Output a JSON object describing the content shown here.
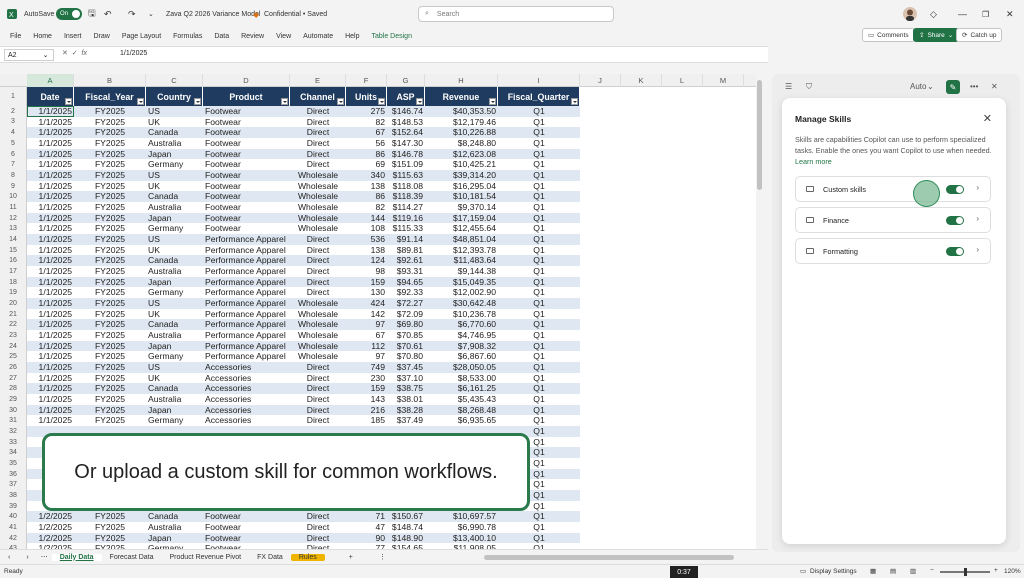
{
  "titlebar": {
    "autosave_label": "AutoSave",
    "autosave_state": "On",
    "file_name": "Zava Q2 2026 Variance Model",
    "sensitivity": "Confidential • Saved",
    "search_placeholder": "Search"
  },
  "menu": [
    "File",
    "Home",
    "Insert",
    "Draw",
    "Page Layout",
    "Formulas",
    "Data",
    "Review",
    "View",
    "Automate",
    "Help",
    "Table Design"
  ],
  "ribbon_right": {
    "comments": "Comments",
    "share": "Share",
    "catchup": "Catch up"
  },
  "formula": {
    "namebox": "A2",
    "fx": "fx",
    "value": "1/1/2025"
  },
  "grid": {
    "col_letters": [
      "A",
      "B",
      "C",
      "D",
      "E",
      "F",
      "G",
      "H",
      "I",
      "J",
      "K",
      "L",
      "M"
    ],
    "headers": [
      "Date",
      "Fiscal_Year",
      "Country",
      "Product",
      "Channel",
      "Units",
      "ASP",
      "Revenue",
      "Fiscal_Quarter"
    ],
    "rows": [
      [
        "1/1/2025",
        "FY2025",
        "US",
        "Footwear",
        "Direct",
        "275",
        "$146.74",
        "$40,353.50",
        "Q1"
      ],
      [
        "1/1/2025",
        "FY2025",
        "UK",
        "Footwear",
        "Direct",
        "82",
        "$148.53",
        "$12,179.46",
        "Q1"
      ],
      [
        "1/1/2025",
        "FY2025",
        "Canada",
        "Footwear",
        "Direct",
        "67",
        "$152.64",
        "$10,226.88",
        "Q1"
      ],
      [
        "1/1/2025",
        "FY2025",
        "Australia",
        "Footwear",
        "Direct",
        "56",
        "$147.30",
        "$8,248.80",
        "Q1"
      ],
      [
        "1/1/2025",
        "FY2025",
        "Japan",
        "Footwear",
        "Direct",
        "86",
        "$146.78",
        "$12,623.08",
        "Q1"
      ],
      [
        "1/1/2025",
        "FY2025",
        "Germany",
        "Footwear",
        "Direct",
        "69",
        "$151.09",
        "$10,425.21",
        "Q1"
      ],
      [
        "1/1/2025",
        "FY2025",
        "US",
        "Footwear",
        "Wholesale",
        "340",
        "$115.63",
        "$39,314.20",
        "Q1"
      ],
      [
        "1/1/2025",
        "FY2025",
        "UK",
        "Footwear",
        "Wholesale",
        "138",
        "$118.08",
        "$16,295.04",
        "Q1"
      ],
      [
        "1/1/2025",
        "FY2025",
        "Canada",
        "Footwear",
        "Wholesale",
        "86",
        "$118.39",
        "$10,181.54",
        "Q1"
      ],
      [
        "1/1/2025",
        "FY2025",
        "Australia",
        "Footwear",
        "Wholesale",
        "82",
        "$114.27",
        "$9,370.14",
        "Q1"
      ],
      [
        "1/1/2025",
        "FY2025",
        "Japan",
        "Footwear",
        "Wholesale",
        "144",
        "$119.16",
        "$17,159.04",
        "Q1"
      ],
      [
        "1/1/2025",
        "FY2025",
        "Germany",
        "Footwear",
        "Wholesale",
        "108",
        "$115.33",
        "$12,455.64",
        "Q1"
      ],
      [
        "1/1/2025",
        "FY2025",
        "US",
        "Performance Apparel",
        "Direct",
        "536",
        "$91.14",
        "$48,851.04",
        "Q1"
      ],
      [
        "1/1/2025",
        "FY2025",
        "UK",
        "Performance Apparel",
        "Direct",
        "138",
        "$89.81",
        "$12,393.78",
        "Q1"
      ],
      [
        "1/1/2025",
        "FY2025",
        "Canada",
        "Performance Apparel",
        "Direct",
        "124",
        "$92.61",
        "$11,483.64",
        "Q1"
      ],
      [
        "1/1/2025",
        "FY2025",
        "Australia",
        "Performance Apparel",
        "Direct",
        "98",
        "$93.31",
        "$9,144.38",
        "Q1"
      ],
      [
        "1/1/2025",
        "FY2025",
        "Japan",
        "Performance Apparel",
        "Direct",
        "159",
        "$94.65",
        "$15,049.35",
        "Q1"
      ],
      [
        "1/1/2025",
        "FY2025",
        "Germany",
        "Performance Apparel",
        "Direct",
        "130",
        "$92.33",
        "$12,002.90",
        "Q1"
      ],
      [
        "1/1/2025",
        "FY2025",
        "US",
        "Performance Apparel",
        "Wholesale",
        "424",
        "$72.27",
        "$30,642.48",
        "Q1"
      ],
      [
        "1/1/2025",
        "FY2025",
        "UK",
        "Performance Apparel",
        "Wholesale",
        "142",
        "$72.09",
        "$10,236.78",
        "Q1"
      ],
      [
        "1/1/2025",
        "FY2025",
        "Canada",
        "Performance Apparel",
        "Wholesale",
        "97",
        "$69.80",
        "$6,770.60",
        "Q1"
      ],
      [
        "1/1/2025",
        "FY2025",
        "Australia",
        "Performance Apparel",
        "Wholesale",
        "67",
        "$70.85",
        "$4,746.95",
        "Q1"
      ],
      [
        "1/1/2025",
        "FY2025",
        "Japan",
        "Performance Apparel",
        "Wholesale",
        "112",
        "$70.61",
        "$7,908.32",
        "Q1"
      ],
      [
        "1/1/2025",
        "FY2025",
        "Germany",
        "Performance Apparel",
        "Wholesale",
        "97",
        "$70.80",
        "$6,867.60",
        "Q1"
      ],
      [
        "1/1/2025",
        "FY2025",
        "US",
        "Accessories",
        "Direct",
        "749",
        "$37.45",
        "$28,050.05",
        "Q1"
      ],
      [
        "1/1/2025",
        "FY2025",
        "UK",
        "Accessories",
        "Direct",
        "230",
        "$37.10",
        "$8,533.00",
        "Q1"
      ],
      [
        "1/1/2025",
        "FY2025",
        "Canada",
        "Accessories",
        "Direct",
        "159",
        "$38.75",
        "$6,161.25",
        "Q1"
      ],
      [
        "1/1/2025",
        "FY2025",
        "Australia",
        "Accessories",
        "Direct",
        "143",
        "$38.01",
        "$5,435.43",
        "Q1"
      ],
      [
        "1/1/2025",
        "FY2025",
        "Japan",
        "Accessories",
        "Direct",
        "216",
        "$38.28",
        "$8,268.48",
        "Q1"
      ],
      [
        "1/1/2025",
        "FY2025",
        "Germany",
        "Accessories",
        "Direct",
        "185",
        "$37.49",
        "$6,935.65",
        "Q1"
      ],
      [
        "",
        "",
        "",
        "",
        "",
        "",
        "",
        "",
        "Q1"
      ],
      [
        "",
        "",
        "",
        "",
        "",
        "",
        "",
        "",
        "Q1"
      ],
      [
        "",
        "",
        "",
        "",
        "",
        "",
        "",
        "",
        "Q1"
      ],
      [
        "",
        "",
        "",
        "",
        "",
        "",
        "",
        "",
        "Q1"
      ],
      [
        "",
        "",
        "",
        "",
        "",
        "",
        "",
        "",
        "Q1"
      ],
      [
        "",
        "",
        "",
        "",
        "",
        "",
        "",
        "",
        "Q1"
      ],
      [
        "",
        "",
        "",
        "",
        "",
        "",
        "",
        "",
        "Q1"
      ],
      [
        "",
        "",
        "",
        "",
        "",
        "",
        "",
        "",
        "Q1"
      ],
      [
        "1/2/2025",
        "FY2025",
        "Canada",
        "Footwear",
        "Direct",
        "71",
        "$150.67",
        "$10,697.57",
        "Q1"
      ],
      [
        "1/2/2025",
        "FY2025",
        "Australia",
        "Footwear",
        "Direct",
        "47",
        "$148.74",
        "$6,990.78",
        "Q1"
      ],
      [
        "1/2/2025",
        "FY2025",
        "Japan",
        "Footwear",
        "Direct",
        "90",
        "$148.90",
        "$13,400.10",
        "Q1"
      ],
      [
        "1/2/2025",
        "FY2025",
        "Germany",
        "Footwear",
        "Direct",
        "77",
        "$154.65",
        "$11,908.05",
        "Q1"
      ]
    ]
  },
  "sheets": [
    "Daily Data",
    "Forecast Data",
    "Product Revenue Pivot",
    "FX Data",
    "Rules"
  ],
  "status": {
    "ready": "Ready",
    "display_settings": "Display Settings",
    "zoom": "120%",
    "video_time": "0:37"
  },
  "pane": {
    "mode": "Auto",
    "title": "Manage Skills",
    "description": "Skills are capabilities Copilot can use to perform specialized tasks. Enable the ones you want Copilot to use when needed.",
    "link": "Learn more",
    "skills": [
      {
        "name": "Custom skills",
        "enabled": true
      },
      {
        "name": "Finance",
        "enabled": true
      },
      {
        "name": "Formatting",
        "enabled": true
      }
    ]
  },
  "caption": "Or upload a custom skill for common workflows.",
  "colors": {
    "excel_green": "#217346",
    "header_navy": "#1f3b5f",
    "band": "#dfe8f2"
  }
}
